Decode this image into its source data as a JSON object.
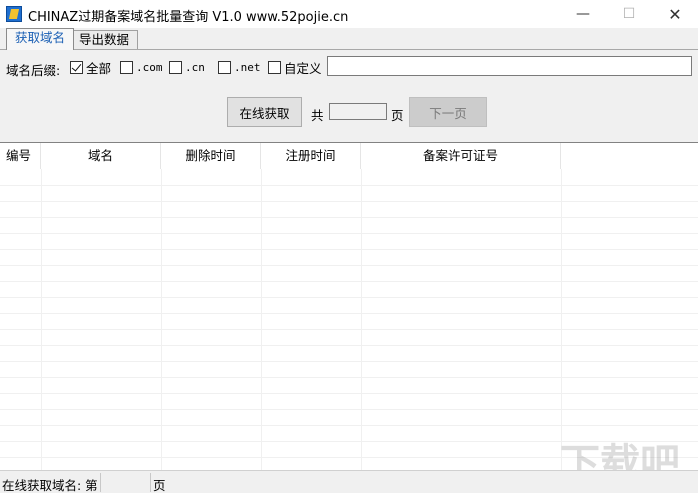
{
  "window": {
    "title": "CHINAZ过期备案域名批量查询 V1.0 www.52pojie.cn",
    "minimize": "—",
    "maximize": "☐",
    "close": "✕"
  },
  "tabs": [
    {
      "label": "获取域名",
      "active": true
    },
    {
      "label": "导出数据",
      "active": false
    }
  ],
  "filters": {
    "suffix_label": "域名后缀:",
    "options": [
      {
        "label": "全部",
        "checked": true
      },
      {
        "label": ".com",
        "checked": false
      },
      {
        "label": ".cn",
        "checked": false
      },
      {
        "label": ".net",
        "checked": false
      },
      {
        "label": "自定义",
        "checked": false
      }
    ],
    "custom_value": ""
  },
  "controls": {
    "fetch_button": "在线获取",
    "total_label": "共",
    "total_value": "",
    "page_label": "页",
    "next_button": "下一页",
    "next_enabled": false
  },
  "table": {
    "columns": [
      "编号",
      "域名",
      "删除时间",
      "注册时间",
      "备案许可证号"
    ],
    "rows": []
  },
  "statusbar": {
    "text": "在线获取域名: 第",
    "page_value": "",
    "page_suffix": "页"
  },
  "colors": {
    "active_tab_text": "#1a5fb4",
    "background": "#f0f0f0"
  }
}
